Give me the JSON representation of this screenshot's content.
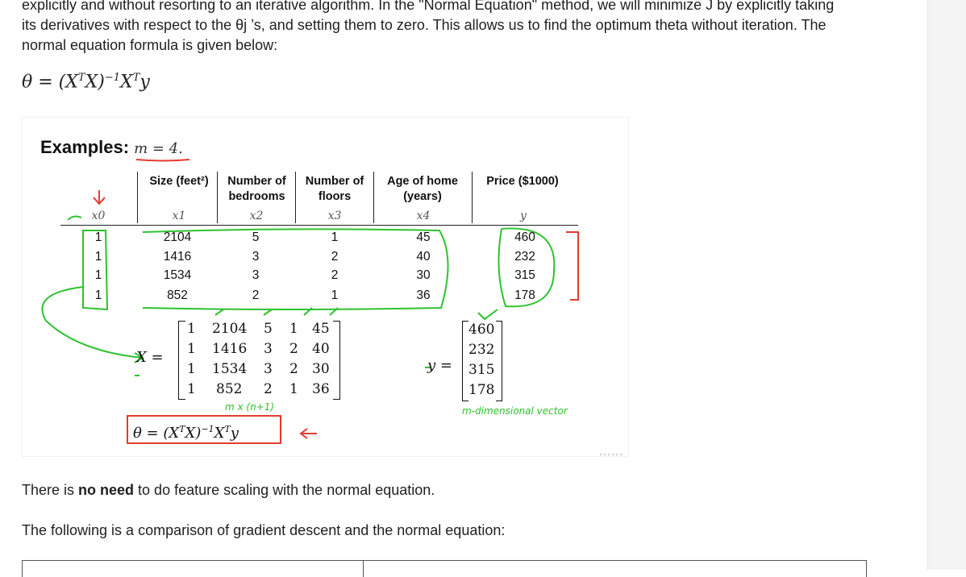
{
  "text": {
    "para1_line1": "explicitly and without resorting to an iterative algorithm. In the \"Normal Equation\" method, we will minimize J by explicitly taking",
    "para1_line2": "its derivatives with respect to the θj ’s, and setting them to zero. This allows us to find the optimum theta without iteration. The",
    "para1_line3": "normal equation formula is given below:",
    "para2_pre": "There is ",
    "para2_bold": "no need",
    "para2_post": " to do feature scaling with the normal equation.",
    "para3": "The following is a comparison of gradient descent and the normal equation:"
  },
  "figure": {
    "examples_label": "Examples:",
    "m_label": "m = 4.",
    "headers": [
      {
        "line1": "Size (feet²)",
        "line2": ""
      },
      {
        "line1": "Number of",
        "line2": "bedrooms"
      },
      {
        "line1": "Number of",
        "line2": "floors"
      },
      {
        "line1": "Age of home",
        "line2": "(years)"
      },
      {
        "line1": "Price ($1000)",
        "line2": ""
      }
    ],
    "vars": [
      "x0",
      "x1",
      "x2",
      "x3",
      "x4",
      "y"
    ],
    "rows": [
      [
        "1",
        "2104",
        "5",
        "1",
        "45",
        "460"
      ],
      [
        "1",
        "1416",
        "3",
        "2",
        "40",
        "232"
      ],
      [
        "1",
        "1534",
        "3",
        "2",
        "30",
        "315"
      ],
      [
        "1",
        "852",
        "2",
        "1",
        "36",
        "178"
      ]
    ],
    "X_label": "X =",
    "X_matrix": [
      [
        "1",
        "2104",
        "5",
        "1",
        "45"
      ],
      [
        "1",
        "1416",
        "3",
        "2",
        "40"
      ],
      [
        "1",
        "1534",
        "3",
        "2",
        "30"
      ],
      [
        "1",
        "852",
        "2",
        "1",
        "36"
      ]
    ],
    "y_label": "y =",
    "y_vector": [
      "460",
      "232",
      "315",
      "178"
    ],
    "dim_note": "m x (n+1)",
    "vector_note": "m-dimensional vector"
  },
  "colors": {
    "annotation_green": "#2ec22e",
    "annotation_red": "#e53b2f"
  }
}
